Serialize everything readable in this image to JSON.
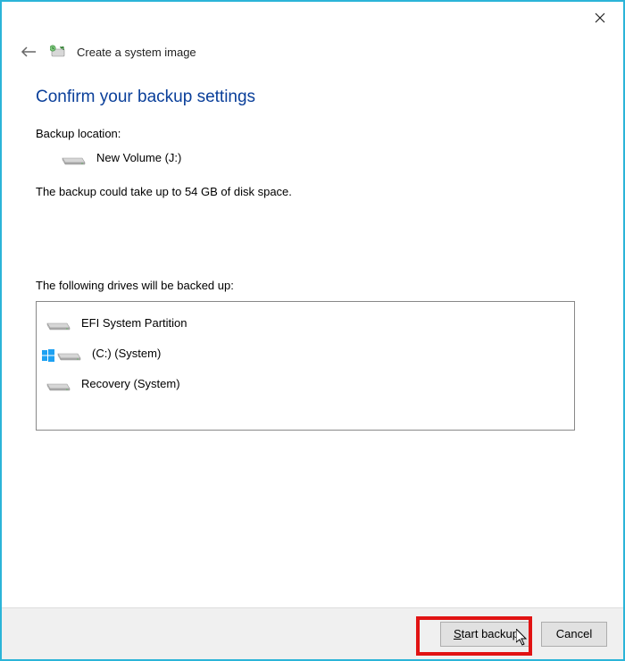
{
  "header": {
    "title": "Create a system image"
  },
  "page": {
    "title": "Confirm your backup settings",
    "backup_location_label": "Backup location:",
    "backup_location_value": "New Volume (J:)",
    "space_info": "The backup could take up to 54 GB of disk space.",
    "drives_label": "The following drives will be backed up:"
  },
  "drives": [
    {
      "name": "EFI System Partition",
      "badge": false
    },
    {
      "name": "(C:) (System)",
      "badge": true
    },
    {
      "name": "Recovery (System)",
      "badge": false
    }
  ],
  "footer": {
    "start_label": "Start backup",
    "cancel_label": "Cancel"
  }
}
